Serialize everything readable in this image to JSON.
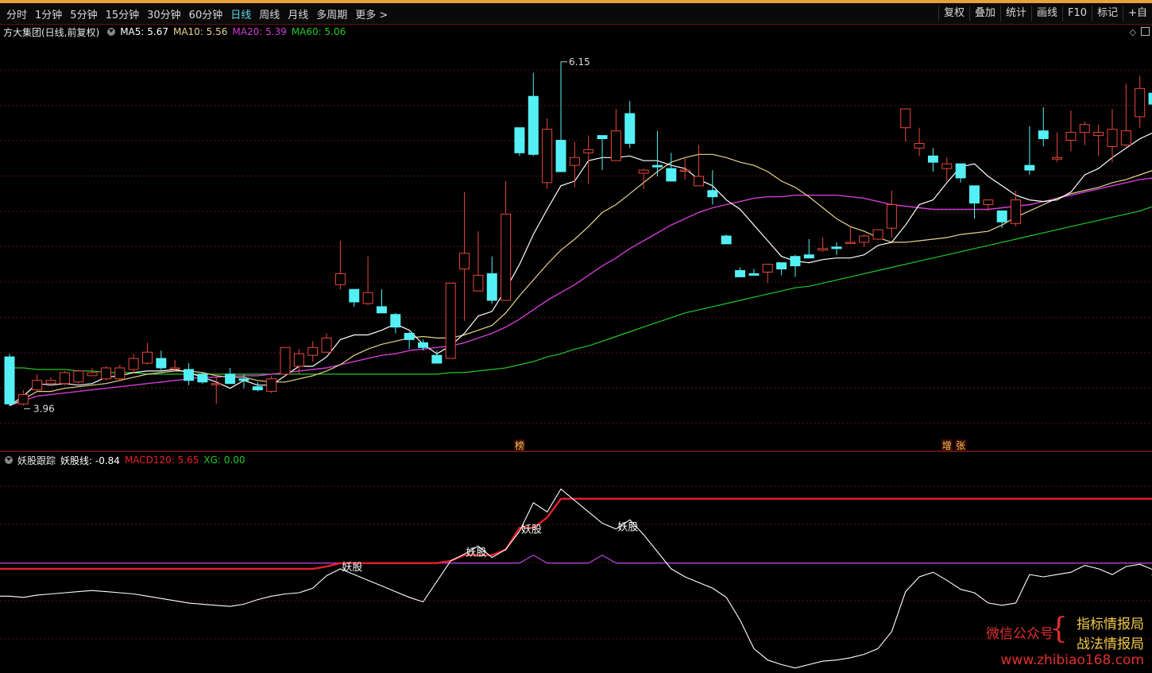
{
  "toolbar": {
    "periods": [
      "分时",
      "1分钟",
      "5分钟",
      "15分钟",
      "30分钟",
      "60分钟",
      "日线",
      "周线",
      "月线",
      "多周期",
      "更多 >"
    ],
    "active": "日线",
    "right_buttons": [
      "复权",
      "叠加",
      "统计",
      "画线",
      "F10",
      "标记",
      "+自"
    ]
  },
  "main_info": {
    "stock": "方大集团(日线,前复权)",
    "ma5": "MA5: 5.67",
    "ma10": "MA10: 5.56",
    "ma20": "MA20: 5.39",
    "ma60": "MA60: 5.06"
  },
  "sub_info": {
    "name": "妖股跟踪",
    "line1": "妖股线: -0.84",
    "line2": "MACD120: 5.65",
    "line3": "XG: 0.00"
  },
  "watermark": {
    "label": "微信公众号",
    "name1": "指标情报局",
    "name2": "战法情报局",
    "url": "www.zhibiao168.com"
  },
  "colors": {
    "up": "#e8483a",
    "down": "#54f0f5",
    "ma5": "#ffffff",
    "ma10": "#e6d58c",
    "ma20": "#d23cd4",
    "ma60": "#22c828",
    "yao": "#ffffff",
    "macd120": "#e8202a",
    "xg": "#b040d0"
  },
  "chart_data": {
    "type": "candlestick",
    "high_label": "6.15",
    "low_label": "3.96",
    "event_markers": [
      {
        "index": 37,
        "text": "榜"
      },
      {
        "index": 68,
        "text": "增"
      },
      {
        "index": 69,
        "text": "张"
      }
    ],
    "candles": [
      [
        4.27,
        3.97,
        4.29,
        3.96
      ],
      [
        3.97,
        4.03,
        4.06,
        3.96
      ],
      [
        4.06,
        4.12,
        4.16,
        4.05
      ],
      [
        4.1,
        4.12,
        4.14,
        4.09
      ],
      [
        4.1,
        4.17,
        4.18,
        4.09
      ],
      [
        4.11,
        4.18,
        4.19,
        4.1
      ],
      [
        4.15,
        4.17,
        4.2,
        4.15
      ],
      [
        4.13,
        4.2,
        4.21,
        4.12
      ],
      [
        4.13,
        4.2,
        4.22,
        4.12
      ],
      [
        4.19,
        4.26,
        4.29,
        4.16
      ],
      [
        4.23,
        4.3,
        4.36,
        4.22
      ],
      [
        4.26,
        4.2,
        4.31,
        4.18
      ],
      [
        4.2,
        4.2,
        4.25,
        4.19
      ],
      [
        4.19,
        4.12,
        4.23,
        4.09
      ],
      [
        4.16,
        4.11,
        4.17,
        4.1
      ],
      [
        4.1,
        4.1,
        4.16,
        3.97
      ],
      [
        4.16,
        4.1,
        4.2,
        4.1
      ],
      [
        4.13,
        4.12,
        4.16,
        4.07
      ],
      [
        4.08,
        4.06,
        4.11,
        4.05
      ],
      [
        4.05,
        4.13,
        4.15,
        4.04
      ],
      [
        4.16,
        4.33,
        4.33,
        4.15
      ],
      [
        4.21,
        4.29,
        4.32,
        4.16
      ],
      [
        4.28,
        4.33,
        4.37,
        4.24
      ],
      [
        4.3,
        4.39,
        4.42,
        4.3
      ],
      [
        4.73,
        4.8,
        5.01,
        4.7
      ],
      [
        4.7,
        4.62,
        4.67,
        4.59
      ],
      [
        4.61,
        4.68,
        4.91,
        4.6
      ],
      [
        4.59,
        4.55,
        4.7,
        4.55
      ],
      [
        4.54,
        4.46,
        4.55,
        4.42
      ],
      [
        4.42,
        4.38,
        4.43,
        4.32
      ],
      [
        4.36,
        4.33,
        4.38,
        4.31
      ],
      [
        4.28,
        4.23,
        4.31,
        4.26
      ],
      [
        4.26,
        4.74,
        4.74,
        4.26
      ],
      [
        4.83,
        4.93,
        5.32,
        4.5
      ],
      [
        4.69,
        4.79,
        5.07,
        4.69
      ],
      [
        4.8,
        4.63,
        4.91,
        4.61
      ],
      [
        4.63,
        5.18,
        5.39,
        4.63
      ],
      [
        5.73,
        5.57,
        5.71,
        5.55
      ],
      [
        5.93,
        5.56,
        6.08,
        5.55
      ],
      [
        5.38,
        5.72,
        5.79,
        5.34
      ],
      [
        5.65,
        5.45,
        6.15,
        5.5
      ],
      [
        5.49,
        5.54,
        5.64,
        5.35
      ],
      [
        5.57,
        5.59,
        5.68,
        5.37
      ],
      [
        5.68,
        5.66,
        5.6,
        5.46
      ],
      [
        5.52,
        5.71,
        5.85,
        5.52
      ],
      [
        5.82,
        5.63,
        5.9,
        5.6
      ],
      [
        5.44,
        5.46,
        5.47,
        5.34
      ],
      [
        5.49,
        5.48,
        5.71,
        5.42
      ],
      [
        5.47,
        5.39,
        5.57,
        5.43
      ],
      [
        5.46,
        5.46,
        5.54,
        5.4
      ],
      [
        5.36,
        5.42,
        5.62,
        5.39
      ],
      [
        5.33,
        5.29,
        5.46,
        5.24
      ],
      [
        5.04,
        4.99,
        5.05,
        4.99
      ],
      [
        4.82,
        4.78,
        4.84,
        4.82
      ],
      [
        4.8,
        4.79,
        4.83,
        4.83
      ],
      [
        4.81,
        4.86,
        4.86,
        4.74
      ],
      [
        4.87,
        4.83,
        4.87,
        4.79
      ],
      [
        4.91,
        4.85,
        4.92,
        4.78
      ],
      [
        4.92,
        4.9,
        5.02,
        4.93
      ],
      [
        4.95,
        4.96,
        5.03,
        4.94
      ],
      [
        4.97,
        4.96,
        5.0,
        4.92
      ],
      [
        5.0,
        5.0,
        5.1,
        5.01
      ],
      [
        5.0,
        5.04,
        5.05,
        4.97
      ],
      [
        5.02,
        5.08,
        5.07,
        5.03
      ],
      [
        5.09,
        5.24,
        5.33,
        5.03
      ],
      [
        5.73,
        5.85,
        5.82,
        5.64
      ],
      [
        5.6,
        5.63,
        5.73,
        5.55
      ],
      [
        5.55,
        5.51,
        5.6,
        5.45
      ],
      [
        5.47,
        5.5,
        5.54,
        5.39
      ],
      [
        5.5,
        5.41,
        5.5,
        5.38
      ],
      [
        5.36,
        5.25,
        5.29,
        5.15
      ],
      [
        5.24,
        5.27,
        5.24,
        5.2
      ],
      [
        5.2,
        5.13,
        5.2,
        5.09
      ],
      [
        5.12,
        5.27,
        5.33,
        5.1
      ],
      [
        5.49,
        5.46,
        5.74,
        5.43
      ],
      [
        5.71,
        5.66,
        5.86,
        5.61
      ],
      [
        5.53,
        5.54,
        5.7,
        5.51
      ],
      [
        5.65,
        5.7,
        5.84,
        5.58
      ],
      [
        5.7,
        5.75,
        5.77,
        5.62
      ],
      [
        5.68,
        5.7,
        5.75,
        5.55
      ],
      [
        5.61,
        5.72,
        5.85,
        5.51
      ],
      [
        5.62,
        5.71,
        6.01,
        5.61
      ],
      [
        5.8,
        5.98,
        6.06,
        5.73
      ],
      [
        5.95,
        5.88,
        6.11,
        5.75
      ]
    ],
    "ma5": [
      3.96,
      4.02,
      4.1,
      4.09,
      4.1,
      4.09,
      4.1,
      4.14,
      4.15,
      4.17,
      4.18,
      4.18,
      4.19,
      4.17,
      4.14,
      4.11,
      4.07,
      4.12,
      4.09,
      4.09,
      4.15,
      4.21,
      4.21,
      4.27,
      4.38,
      4.41,
      4.41,
      4.44,
      4.48,
      4.44,
      4.35,
      4.29,
      4.34,
      4.42,
      4.53,
      4.56,
      4.7,
      4.86,
      5.05,
      5.21,
      5.36,
      5.39,
      5.52,
      5.54,
      5.54,
      5.55,
      5.52,
      5.52,
      5.49,
      5.47,
      5.4,
      5.36,
      5.27,
      5.21,
      5.11,
      5.01,
      4.91,
      4.88,
      4.87,
      4.89,
      4.9,
      4.9,
      4.92,
      4.98,
      5.0,
      5.11,
      5.24,
      5.27,
      5.38,
      5.48,
      5.5,
      5.42,
      5.36,
      5.3,
      5.27,
      5.26,
      5.27,
      5.32,
      5.43,
      5.47,
      5.54,
      5.6,
      5.66,
      5.7
    ],
    "ma10": [
      3.96,
      4.0,
      4.05,
      4.05,
      4.07,
      4.08,
      4.09,
      4.1,
      4.12,
      4.14,
      4.16,
      4.17,
      4.18,
      4.18,
      4.17,
      4.15,
      4.14,
      4.14,
      4.12,
      4.11,
      4.11,
      4.13,
      4.15,
      4.18,
      4.22,
      4.28,
      4.32,
      4.35,
      4.37,
      4.39,
      4.4,
      4.39,
      4.39,
      4.41,
      4.44,
      4.47,
      4.55,
      4.66,
      4.76,
      4.86,
      4.95,
      5.02,
      5.1,
      5.19,
      5.24,
      5.31,
      5.38,
      5.45,
      5.51,
      5.54,
      5.56,
      5.56,
      5.54,
      5.51,
      5.49,
      5.45,
      5.39,
      5.35,
      5.29,
      5.22,
      5.15,
      5.1,
      5.07,
      5.03,
      5.0,
      5.0,
      5.01,
      5.02,
      5.03,
      5.05,
      5.06,
      5.07,
      5.11,
      5.16,
      5.2,
      5.24,
      5.28,
      5.31,
      5.33,
      5.35,
      5.38,
      5.4,
      5.43,
      5.46
    ],
    "ma20": [
      3.96,
      3.99,
      4.02,
      4.03,
      4.04,
      4.05,
      4.06,
      4.07,
      4.08,
      4.09,
      4.1,
      4.11,
      4.12,
      4.13,
      4.14,
      4.14,
      4.15,
      4.15,
      4.15,
      4.16,
      4.17,
      4.18,
      4.19,
      4.2,
      4.22,
      4.24,
      4.26,
      4.28,
      4.29,
      4.31,
      4.32,
      4.33,
      4.34,
      4.36,
      4.39,
      4.42,
      4.46,
      4.51,
      4.57,
      4.63,
      4.68,
      4.73,
      4.79,
      4.85,
      4.9,
      4.96,
      5.01,
      5.06,
      5.11,
      5.15,
      5.19,
      5.22,
      5.24,
      5.26,
      5.28,
      5.29,
      5.29,
      5.3,
      5.3,
      5.3,
      5.3,
      5.29,
      5.28,
      5.26,
      5.24,
      5.23,
      5.22,
      5.21,
      5.21,
      5.21,
      5.21,
      5.21,
      5.22,
      5.23,
      5.24,
      5.26,
      5.28,
      5.3,
      5.32,
      5.34,
      5.36,
      5.38,
      5.4,
      5.41
    ],
    "ma60": [
      4.2,
      4.2,
      4.19,
      4.19,
      4.19,
      4.18,
      4.18,
      4.17,
      4.17,
      4.17,
      4.16,
      4.16,
      4.16,
      4.16,
      4.16,
      4.16,
      4.16,
      4.16,
      4.16,
      4.16,
      4.16,
      4.16,
      4.16,
      4.16,
      4.16,
      4.16,
      4.16,
      4.16,
      4.16,
      4.16,
      4.16,
      4.16,
      4.17,
      4.17,
      4.18,
      4.19,
      4.2,
      4.22,
      4.24,
      4.27,
      4.29,
      4.32,
      4.34,
      4.37,
      4.4,
      4.43,
      4.46,
      4.49,
      4.52,
      4.55,
      4.57,
      4.59,
      4.61,
      4.63,
      4.65,
      4.67,
      4.69,
      4.71,
      4.72,
      4.74,
      4.76,
      4.78,
      4.8,
      4.82,
      4.84,
      4.86,
      4.88,
      4.9,
      4.92,
      4.94,
      4.96,
      4.98,
      5.0,
      5.02,
      5.04,
      5.06,
      5.08,
      5.1,
      5.12,
      5.14,
      5.16,
      5.18,
      5.2,
      5.23
    ],
    "yao": [
      -2.9,
      -3.0,
      -2.8,
      -2.7,
      -2.6,
      -2.5,
      -2.4,
      -2.5,
      -2.6,
      -2.7,
      -2.9,
      -3.1,
      -3.3,
      -3.5,
      -3.6,
      -3.7,
      -3.8,
      -3.6,
      -3.2,
      -2.9,
      -2.7,
      -2.6,
      -2.2,
      -1.1,
      -0.5,
      -1.0,
      -1.5,
      -2.0,
      -2.5,
      -3.0,
      -3.4,
      -1.6,
      0.2,
      0.8,
      1.5,
      0.5,
      1.2,
      2.8,
      5.3,
      4.5,
      6.5,
      5.5,
      4.5,
      3.5,
      3.0,
      3.8,
      2.5,
      1.0,
      -0.5,
      -1.2,
      -1.7,
      -2.2,
      -3.0,
      -5.0,
      -7.5,
      -8.5,
      -8.9,
      -9.2,
      -8.9,
      -8.6,
      -8.5,
      -8.3,
      -8.0,
      -7.5,
      -6.0,
      -2.5,
      -1.2,
      -0.8,
      -1.5,
      -2.3,
      -2.6,
      -3.5,
      -3.7,
      -3.5,
      -1.0,
      -1.2,
      -1.0,
      -0.8,
      -0.2,
      -0.5,
      -1.0,
      -0.3,
      -0.1,
      -0.6
    ],
    "macd120": [
      -0.5,
      -0.5,
      -0.5,
      -0.5,
      -0.5,
      -0.5,
      -0.5,
      -0.5,
      -0.5,
      -0.5,
      -0.5,
      -0.5,
      -0.5,
      -0.5,
      -0.5,
      -0.5,
      -0.5,
      -0.5,
      -0.5,
      -0.5,
      -0.5,
      -0.5,
      -0.5,
      -0.3,
      0.0,
      0.0,
      0.0,
      0.0,
      0.0,
      0.0,
      0.0,
      0.0,
      0.2,
      0.7,
      0.7,
      0.7,
      1.2,
      3.1,
      3.1,
      4.0,
      5.65,
      5.65,
      5.65,
      5.65,
      5.65,
      5.65,
      5.65,
      5.65,
      5.65,
      5.65,
      5.65,
      5.65,
      5.65,
      5.65,
      5.65,
      5.65,
      5.65,
      5.65,
      5.65,
      5.65,
      5.65,
      5.65,
      5.65,
      5.65,
      5.65,
      5.65,
      5.65,
      5.65,
      5.65,
      5.65,
      5.65,
      5.65,
      5.65,
      5.65,
      5.65,
      5.65,
      5.65,
      5.65,
      5.65,
      5.65,
      5.65,
      5.65,
      5.65,
      5.65
    ],
    "xg_line": 0.0,
    "xg_bumps": [
      {
        "index": 38,
        "value": 0.7
      },
      {
        "index": 43,
        "value": 0.7
      }
    ],
    "yao_labels": [
      {
        "index": 24,
        "text": "妖股"
      },
      {
        "index": 33,
        "text": "妖股"
      },
      {
        "index": 37,
        "text": "妖股"
      },
      {
        "index": 44,
        "text": "妖股"
      }
    ],
    "price_range": [
      3.8,
      6.25
    ],
    "indicator_range": [
      -9.5,
      8.0
    ],
    "grid": true
  }
}
